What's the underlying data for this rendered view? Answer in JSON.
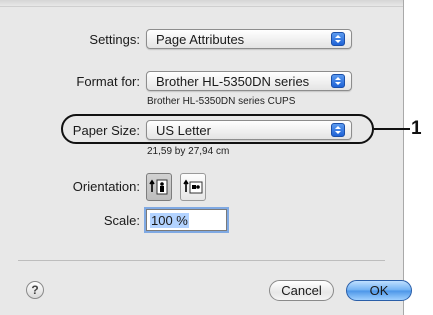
{
  "settings": {
    "label": "Settings:",
    "value": "Page Attributes"
  },
  "format_for": {
    "label": "Format for:",
    "value": "Brother HL-5350DN series",
    "subtitle": "Brother HL-5350DN series CUPS"
  },
  "paper_size": {
    "label": "Paper Size:",
    "value": "US Letter",
    "dimensions": "21,59 by 27,94 cm"
  },
  "orientation": {
    "label": "Orientation:",
    "options": [
      "portrait-icon",
      "landscape-icon"
    ],
    "selected": "portrait"
  },
  "scale": {
    "label": "Scale:",
    "value": "100 %"
  },
  "buttons": {
    "help": "?",
    "cancel": "Cancel",
    "ok": "OK"
  },
  "callout": {
    "number": "1"
  },
  "colors": {
    "accent": "#3b82e6",
    "panel": "#e8e8e8"
  }
}
